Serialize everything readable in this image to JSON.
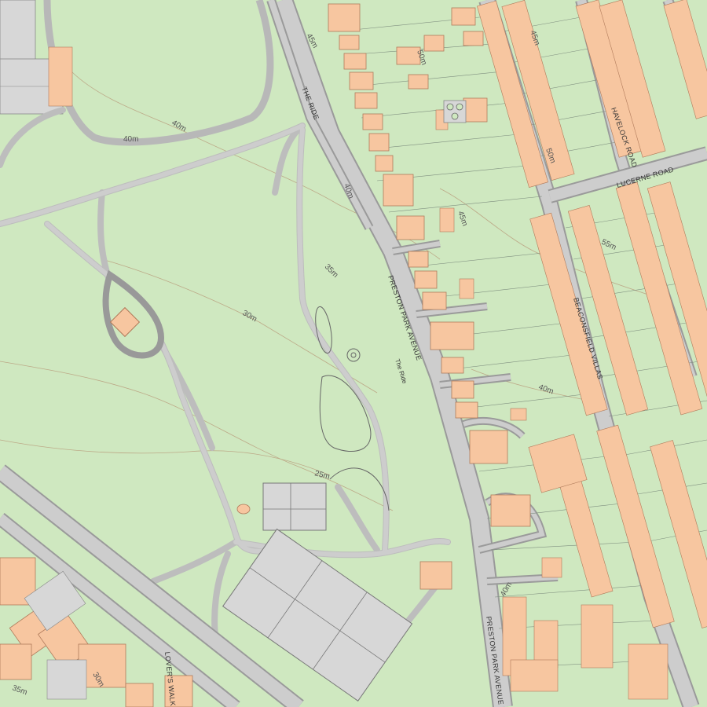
{
  "map": {
    "colors": {
      "park": "#cfe8c0",
      "road": "#cdcdcd",
      "road_edge": "#9a9a9a",
      "building": "#f7c6a0",
      "building_edge": "#b07a5a",
      "hardstanding": "#d7d7d7",
      "contour": "#b89a7a",
      "plot_line": "#7f8f7f"
    },
    "street_labels": {
      "the_ride_north": "THE RIDE",
      "preston_park_avenue": "PRESTON PARK AVENUE",
      "preston_park_avenue_south": "PRESTON PARK AVENUE",
      "the_ride_path": "The Ride",
      "havelock_road": "HAVELOCK ROAD",
      "lucerne_road": "LUCERNE ROAD",
      "beaconsfield_villas": "BEACONSFIELD VILLAS",
      "lovers_walk": "LOVER'S WALK"
    },
    "contour_labels": {
      "c45": "45m",
      "c40a": "40m",
      "c40b": "40m",
      "c40c": "40m",
      "c40d": "40m",
      "c35": "35m",
      "c30": "30m",
      "c25": "25m",
      "c30b": "30m",
      "c35b": "35m",
      "c45b": "45m",
      "c50a": "50m",
      "c55": "55m",
      "c50b": "50m",
      "c40e": "40m",
      "c45c": "45m"
    }
  }
}
